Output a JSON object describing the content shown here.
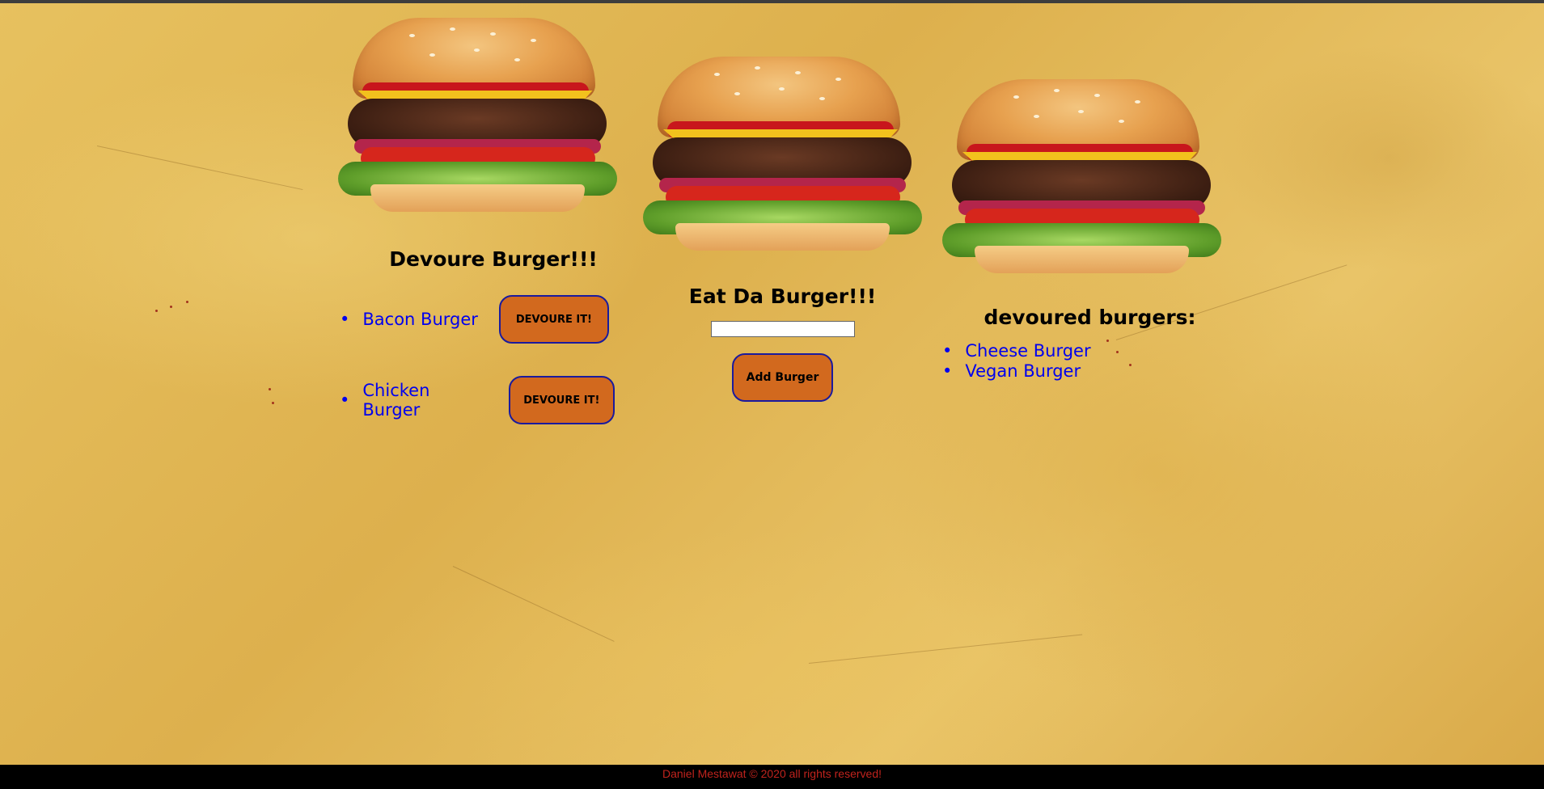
{
  "columns": {
    "devour": {
      "title": "Devoure Burger!!!",
      "items": [
        {
          "name": "Bacon Burger",
          "button_label": "DEVOURE IT!"
        },
        {
          "name": "Chicken Burger",
          "button_label": "DEVOURE IT!"
        }
      ]
    },
    "add": {
      "title": "Eat Da Burger!!!",
      "input_value": "",
      "button_label": "Add Burger"
    },
    "devoured": {
      "title": "devoured burgers:",
      "items": [
        "Cheese Burger",
        "Vegan Burger"
      ]
    }
  },
  "footer": {
    "text": "Daniel Mestawat © 2020 all rights reserved!"
  },
  "colors": {
    "button": "#d2691e",
    "button_border": "#1a1a9e",
    "link": "#0000ee",
    "footer_text": "#c0231d",
    "footer_bg": "#000000"
  },
  "icons": {
    "bullet": "•"
  }
}
